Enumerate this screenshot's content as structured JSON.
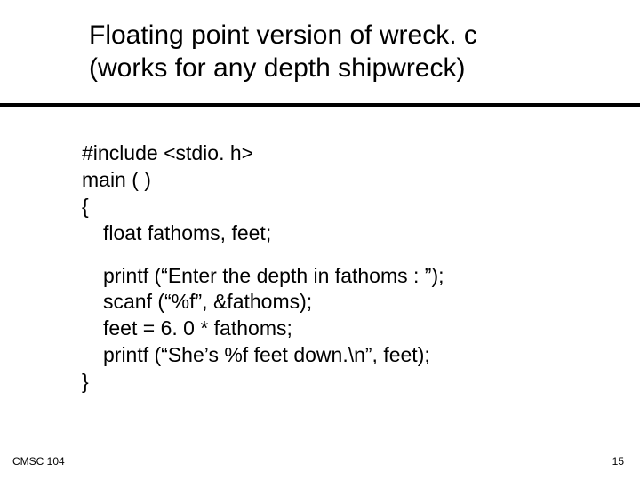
{
  "title_line1": "Floating point version of wreck. c",
  "title_line2": "(works for any depth shipwreck)",
  "code": {
    "l1": "#include <stdio. h>",
    "l2": "main ( )",
    "l3": "{",
    "l4": "float fathoms, feet;",
    "l5": "printf (“Enter the depth in fathoms : ”);",
    "l6": "scanf (“%f”, &fathoms);",
    "l7": "feet = 6. 0 * fathoms;",
    "l8": "printf (“She’s %f feet down.\\n”, feet);",
    "l9": "}"
  },
  "footer": {
    "left": "CMSC 104",
    "right": "15"
  }
}
